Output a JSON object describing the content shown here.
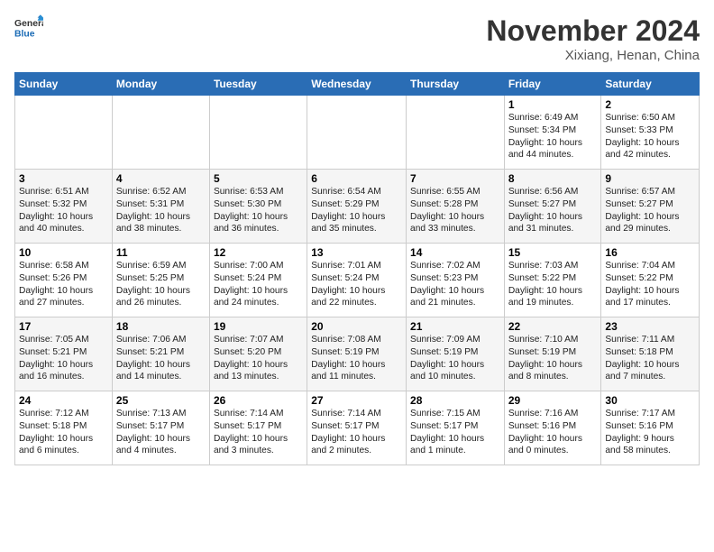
{
  "header": {
    "logo_general": "General",
    "logo_blue": "Blue",
    "month_title": "November 2024",
    "location": "Xixiang, Henan, China"
  },
  "days_of_week": [
    "Sunday",
    "Monday",
    "Tuesday",
    "Wednesday",
    "Thursday",
    "Friday",
    "Saturday"
  ],
  "weeks": [
    [
      {
        "day": "",
        "info": ""
      },
      {
        "day": "",
        "info": ""
      },
      {
        "day": "",
        "info": ""
      },
      {
        "day": "",
        "info": ""
      },
      {
        "day": "",
        "info": ""
      },
      {
        "day": "1",
        "info": "Sunrise: 6:49 AM\nSunset: 5:34 PM\nDaylight: 10 hours\nand 44 minutes."
      },
      {
        "day": "2",
        "info": "Sunrise: 6:50 AM\nSunset: 5:33 PM\nDaylight: 10 hours\nand 42 minutes."
      }
    ],
    [
      {
        "day": "3",
        "info": "Sunrise: 6:51 AM\nSunset: 5:32 PM\nDaylight: 10 hours\nand 40 minutes."
      },
      {
        "day": "4",
        "info": "Sunrise: 6:52 AM\nSunset: 5:31 PM\nDaylight: 10 hours\nand 38 minutes."
      },
      {
        "day": "5",
        "info": "Sunrise: 6:53 AM\nSunset: 5:30 PM\nDaylight: 10 hours\nand 36 minutes."
      },
      {
        "day": "6",
        "info": "Sunrise: 6:54 AM\nSunset: 5:29 PM\nDaylight: 10 hours\nand 35 minutes."
      },
      {
        "day": "7",
        "info": "Sunrise: 6:55 AM\nSunset: 5:28 PM\nDaylight: 10 hours\nand 33 minutes."
      },
      {
        "day": "8",
        "info": "Sunrise: 6:56 AM\nSunset: 5:27 PM\nDaylight: 10 hours\nand 31 minutes."
      },
      {
        "day": "9",
        "info": "Sunrise: 6:57 AM\nSunset: 5:27 PM\nDaylight: 10 hours\nand 29 minutes."
      }
    ],
    [
      {
        "day": "10",
        "info": "Sunrise: 6:58 AM\nSunset: 5:26 PM\nDaylight: 10 hours\nand 27 minutes."
      },
      {
        "day": "11",
        "info": "Sunrise: 6:59 AM\nSunset: 5:25 PM\nDaylight: 10 hours\nand 26 minutes."
      },
      {
        "day": "12",
        "info": "Sunrise: 7:00 AM\nSunset: 5:24 PM\nDaylight: 10 hours\nand 24 minutes."
      },
      {
        "day": "13",
        "info": "Sunrise: 7:01 AM\nSunset: 5:24 PM\nDaylight: 10 hours\nand 22 minutes."
      },
      {
        "day": "14",
        "info": "Sunrise: 7:02 AM\nSunset: 5:23 PM\nDaylight: 10 hours\nand 21 minutes."
      },
      {
        "day": "15",
        "info": "Sunrise: 7:03 AM\nSunset: 5:22 PM\nDaylight: 10 hours\nand 19 minutes."
      },
      {
        "day": "16",
        "info": "Sunrise: 7:04 AM\nSunset: 5:22 PM\nDaylight: 10 hours\nand 17 minutes."
      }
    ],
    [
      {
        "day": "17",
        "info": "Sunrise: 7:05 AM\nSunset: 5:21 PM\nDaylight: 10 hours\nand 16 minutes."
      },
      {
        "day": "18",
        "info": "Sunrise: 7:06 AM\nSunset: 5:21 PM\nDaylight: 10 hours\nand 14 minutes."
      },
      {
        "day": "19",
        "info": "Sunrise: 7:07 AM\nSunset: 5:20 PM\nDaylight: 10 hours\nand 13 minutes."
      },
      {
        "day": "20",
        "info": "Sunrise: 7:08 AM\nSunset: 5:19 PM\nDaylight: 10 hours\nand 11 minutes."
      },
      {
        "day": "21",
        "info": "Sunrise: 7:09 AM\nSunset: 5:19 PM\nDaylight: 10 hours\nand 10 minutes."
      },
      {
        "day": "22",
        "info": "Sunrise: 7:10 AM\nSunset: 5:19 PM\nDaylight: 10 hours\nand 8 minutes."
      },
      {
        "day": "23",
        "info": "Sunrise: 7:11 AM\nSunset: 5:18 PM\nDaylight: 10 hours\nand 7 minutes."
      }
    ],
    [
      {
        "day": "24",
        "info": "Sunrise: 7:12 AM\nSunset: 5:18 PM\nDaylight: 10 hours\nand 6 minutes."
      },
      {
        "day": "25",
        "info": "Sunrise: 7:13 AM\nSunset: 5:17 PM\nDaylight: 10 hours\nand 4 minutes."
      },
      {
        "day": "26",
        "info": "Sunrise: 7:14 AM\nSunset: 5:17 PM\nDaylight: 10 hours\nand 3 minutes."
      },
      {
        "day": "27",
        "info": "Sunrise: 7:14 AM\nSunset: 5:17 PM\nDaylight: 10 hours\nand 2 minutes."
      },
      {
        "day": "28",
        "info": "Sunrise: 7:15 AM\nSunset: 5:17 PM\nDaylight: 10 hours\nand 1 minute."
      },
      {
        "day": "29",
        "info": "Sunrise: 7:16 AM\nSunset: 5:16 PM\nDaylight: 10 hours\nand 0 minutes."
      },
      {
        "day": "30",
        "info": "Sunrise: 7:17 AM\nSunset: 5:16 PM\nDaylight: 9 hours\nand 58 minutes."
      }
    ]
  ]
}
